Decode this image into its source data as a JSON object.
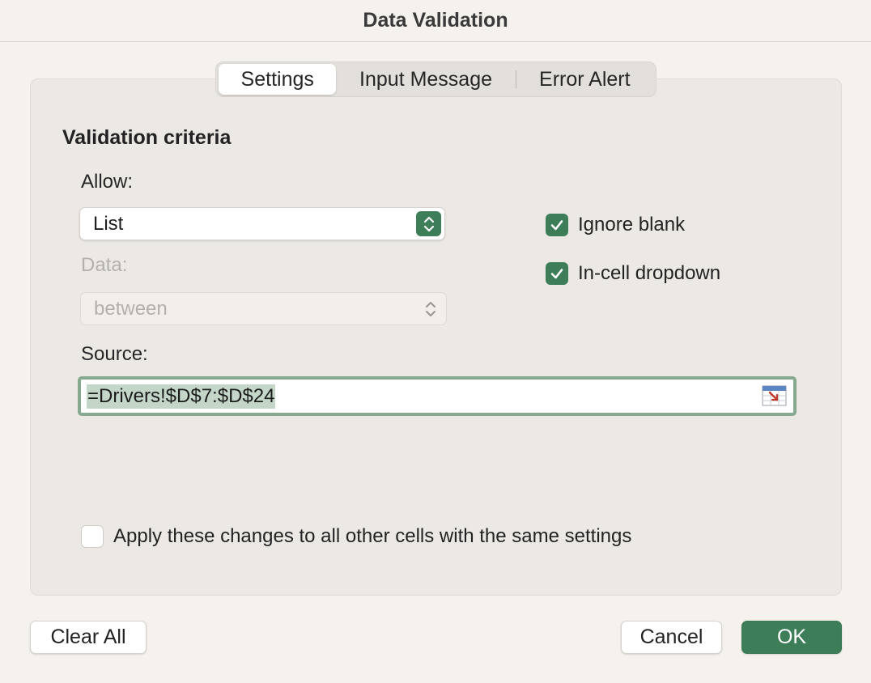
{
  "window": {
    "title": "Data Validation"
  },
  "tabs": [
    {
      "label": "Settings",
      "active": true
    },
    {
      "label": "Input Message",
      "active": false
    },
    {
      "label": "Error Alert",
      "active": false
    }
  ],
  "settings": {
    "section_title": "Validation criteria",
    "allow": {
      "label": "Allow:",
      "value": "List"
    },
    "data": {
      "label": "Data:",
      "value": "between",
      "enabled": false
    },
    "ignore_blank": {
      "label": "Ignore blank",
      "checked": true
    },
    "in_cell_dropdown": {
      "label": "In-cell dropdown",
      "checked": true
    },
    "source": {
      "label": "Source:",
      "value": "=Drivers!$D$7:$D$24"
    },
    "apply_all": {
      "label": "Apply these changes to all other cells with the same settings",
      "checked": false
    }
  },
  "buttons": {
    "clear_all": "Clear All",
    "cancel": "Cancel",
    "ok": "OK"
  },
  "colors": {
    "accent": "#3d7d58",
    "focus_ring": "#86a98f",
    "selection": "#c3d6c8"
  }
}
